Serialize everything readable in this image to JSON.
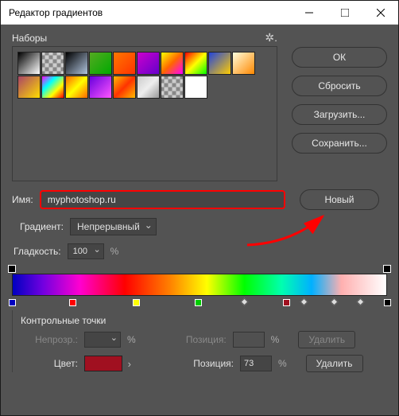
{
  "window": {
    "title": "Редактор градиентов"
  },
  "presets": {
    "label": "Наборы"
  },
  "buttons": {
    "ok": "ОК",
    "reset": "Сбросить",
    "load": "Загрузить...",
    "save": "Сохранить...",
    "new": "Новый"
  },
  "name": {
    "label": "Имя:",
    "value": "myphotoshop.ru"
  },
  "gradient": {
    "label": "Градиент:",
    "type": "Непрерывный"
  },
  "smoothness": {
    "label": "Гладкость:",
    "value": "100",
    "unit": "%"
  },
  "stops": {
    "header": "Контрольные точки",
    "opacity": {
      "label": "Непрозр.:",
      "value": "",
      "unit": "%",
      "position_label": "Позиция:",
      "position": "",
      "delete": "Удалить"
    },
    "color": {
      "label": "Цвет:",
      "value": "#a01020",
      "position_label": "Позиция:",
      "position": "73",
      "unit": "%",
      "delete": "Удалить"
    }
  },
  "swatches": [
    "linear-gradient(135deg,#000,#fff)",
    "repeating-conic-gradient(#888 0 25%,#ccc 0 50%) 50%/10px 10px",
    "linear-gradient(135deg,#000,#b0c4de)",
    "linear-gradient(135deg,#5a2,#0a0)",
    "linear-gradient(135deg,#f70,#f30)",
    "linear-gradient(135deg,#c0c,#60c)",
    "linear-gradient(135deg,#ff0,#f60,#f0f)",
    "linear-gradient(135deg,#f00,#ff0,#0f0)",
    "linear-gradient(135deg,#24d,#fc0)",
    "linear-gradient(135deg,#ffd,#f80)",
    "linear-gradient(135deg,#a46,#fd0)",
    "linear-gradient(135deg,#f0f,#0ff,#ff0,#f00)",
    "linear-gradient(135deg,#f60,#ff0,#f60)",
    "linear-gradient(135deg,#60d,#f5f)",
    "linear-gradient(135deg,#fb0,#f30,#fb0)",
    "linear-gradient(135deg,#ccc,#eee,#999)",
    "repeating-conic-gradient(#888 0 25%,#ccc 0 50%) 50%/10px 10px",
    "#fff"
  ],
  "colorStops": [
    {
      "pos": 0,
      "color": "#0000c0"
    },
    {
      "pos": 16,
      "color": "#ff0000"
    },
    {
      "pos": 33,
      "color": "#ffff00"
    },
    {
      "pos": 49.5,
      "color": "#00cc00"
    },
    {
      "pos": 73,
      "color": "#a01020"
    },
    {
      "pos": 100,
      "color": "#000000"
    }
  ],
  "midpoints": [
    62,
    78,
    86,
    93
  ]
}
